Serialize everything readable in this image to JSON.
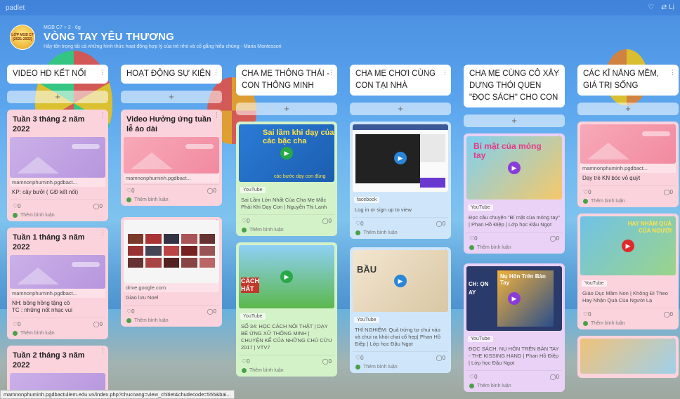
{
  "brand": "padlet",
  "top_right": {
    "heart": "♡",
    "extra": "⇄ Lị"
  },
  "header": {
    "logo_text": "LỚP MGB C7 (2021-2022)",
    "meta": "MGB C7 + 2 · 6g",
    "title": "VÒNG TAY YÊU THƯƠNG",
    "subtitle": "Hãy tôn trọng tất cả những hình thức hoạt động hợp lý của trẻ nhỏ và cố gắng hiểu chúng - Maria Montessori"
  },
  "common": {
    "add": "+",
    "dots": "⋮",
    "heart": "♡0",
    "comment_count": "◯0",
    "add_comment": "Thêm bình luận"
  },
  "columns": [
    {
      "title": "VIDEO HD KẾT NỐI",
      "cards": [
        {
          "title": "Tuần 3 tháng 2 năm 2022",
          "domain": "mamnonphuminh.pgdbact...",
          "desc": "KP: cây bưởi ( GĐ kết nối)"
        },
        {
          "title": "Tuần 1 tháng 3 năm 2022",
          "domain": "mamnonphuminh.pgdbact...",
          "desc1": "NH: bông hồng tặng cô",
          "desc2": "TC : những nốt nhạc vui"
        },
        {
          "title": "Tuần 2 tháng 3 năm 2022"
        }
      ]
    },
    {
      "title": "HOẠT ĐỘNG SỰ KIỆN",
      "cards": [
        {
          "title": "Video Hưởng ứng tuần lễ áo dài",
          "domain": "mamnonphuminh.pgdbact..."
        },
        {
          "domain": "drive.google.com",
          "desc": "Giao lưu Noel"
        }
      ]
    },
    {
      "title": "CHA MẸ THÔNG THÁI - CON THÔNG MINH",
      "cards": [
        {
          "thumb_text": "Sai lầm khi dạy của các bậc cha",
          "thumb_sub": "các bước dạy con đúng",
          "source": "YouTube",
          "desc": "Sai Lầm Lớn Nhất Của Cha Mẹ Mắc Phải Khi Dạy Con | Nguyễn Thị Lanh"
        },
        {
          "thumb_text": "CÁCH HÁT",
          "source": "YouTube",
          "desc": "SỐ 34: HỌC CÁCH NÓI THẬT | DẠY BÉ ỨNG XỬ THÔNG MINH | CHUYỆN KỂ CỦA NHỮNG CHÚ CỪU 2017 | VTV7"
        }
      ]
    },
    {
      "title": "CHA MẸ CHƠI CÙNG CON TẠI NHÀ",
      "cards": [
        {
          "source": "facebook",
          "desc": "Log in or sign up to view"
        },
        {
          "thumb_text": "BẦU",
          "source": "YouTube",
          "desc": "THÍ NGHIỆM: Quả trứng tự chui vào và chui ra khỏi chai cổ hẹp| Phan Hồ Điệp | Lớp học Đậu Ngọt"
        }
      ]
    },
    {
      "title": "CHA MẸ CÙNG CÔ XÂY DỰNG THÓI QUEN \"ĐỌC SÁCH\" CHO CON",
      "cards": [
        {
          "thumb_text": "Bí mật của móng tay",
          "source": "YouTube",
          "desc": "Đọc câu chuyện \"Bí mật của móng tay\" | Phan Hồ Điệp | Lớp học Đậu Ngọt"
        },
        {
          "thumb_text": "Nụ Hôn Trên Bàn Tay",
          "thumb_side": "CH: ỌN AY",
          "source": "YouTube",
          "desc": "ĐỌC SÁCH: NỤ HÔN TRÊN BÀN TAY - THE KISSING HAND | Phan Hồ Điệp | Lớp học Đậu Ngọt"
        }
      ]
    },
    {
      "title": "CÁC KĨ NĂNG MỀM, GIÁ TRỊ SỐNG",
      "cards": [
        {
          "domain": "mamnonphuminh.pgdbact...",
          "desc": "Dạy trẻ KN bóc vỏ quýt"
        },
        {
          "thumb_text": "HAY NHẦM QUÀ CỦA NGƯỜI",
          "source": "YouTube",
          "desc": "Giáo Dục Mầm Non | Không Đi Theo Hay Nhận Quà Của Người Lạ"
        }
      ]
    }
  ],
  "statusbar": "mamnonphuminh.pgdbactuliem.edu.vn/index.php?chucnang=view_chitiet&chudecode=555&bai..."
}
